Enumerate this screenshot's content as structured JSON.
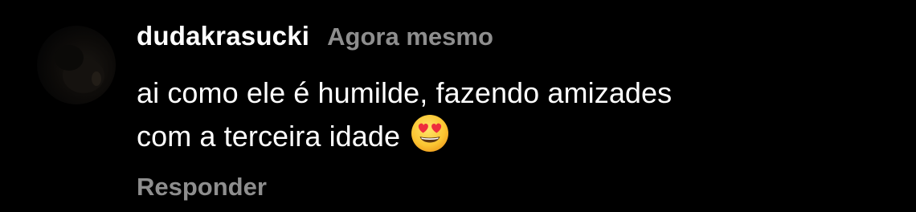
{
  "comment": {
    "username": "dudakrasucki",
    "timestamp": "Agora mesmo",
    "text_line1": "ai como ele é humilde, fazendo amizades",
    "text_line2": "com a terceira idade",
    "reply_label": "Responder",
    "emoji": "smiling-face-with-heart-eyes-icon",
    "colors": {
      "background": "#000000",
      "text": "#ffffff",
      "muted": "#8e8e8e"
    }
  }
}
